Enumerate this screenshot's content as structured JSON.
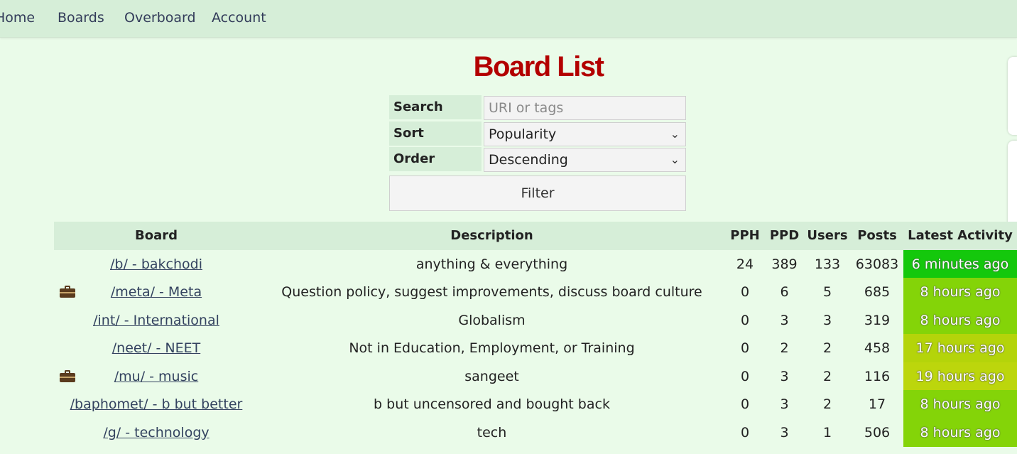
{
  "nav": {
    "home": "Home",
    "boards": "Boards",
    "overboard": "Overboard",
    "account": "Account"
  },
  "page_title": "Board List",
  "filter": {
    "search_label": "Search",
    "search_placeholder": "URI or tags",
    "sort_label": "Sort",
    "sort_value": "Popularity",
    "order_label": "Order",
    "order_value": "Descending",
    "filter_button": "Filter"
  },
  "table": {
    "headers": [
      "Board",
      "Description",
      "PPH",
      "PPD",
      "Users",
      "Posts",
      "Latest Activity"
    ],
    "rows": [
      {
        "board": "/b/ - bakchodi",
        "description": "anything & everything",
        "pph": "24",
        "ppd": "389",
        "users": "133",
        "posts": "63083",
        "activity": "6 minutes ago",
        "activity_color": "#14c80c",
        "sfw_icon": false
      },
      {
        "board": "/meta/ - Meta",
        "description": "Question policy, suggest improvements, discuss board culture",
        "pph": "0",
        "ppd": "6",
        "users": "5",
        "posts": "685",
        "activity": "8 hours ago",
        "activity_color": "#84d408",
        "sfw_icon": true
      },
      {
        "board": "/int/ - International",
        "description": "Globalism",
        "pph": "0",
        "ppd": "3",
        "users": "3",
        "posts": "319",
        "activity": "8 hours ago",
        "activity_color": "#84d408",
        "sfw_icon": false
      },
      {
        "board": "/neet/ - NEET",
        "description": "Not in Education, Employment, or Training",
        "pph": "0",
        "ppd": "2",
        "users": "2",
        "posts": "458",
        "activity": "17 hours ago",
        "activity_color": "#b4d40a",
        "sfw_icon": false
      },
      {
        "board": "/mu/ - music",
        "description": "sangeet",
        "pph": "0",
        "ppd": "3",
        "users": "2",
        "posts": "116",
        "activity": "19 hours ago",
        "activity_color": "#bcd60c",
        "sfw_icon": true
      },
      {
        "board": "/baphomet/ - b but better",
        "description": "b but uncensored and bought back",
        "pph": "0",
        "ppd": "3",
        "users": "2",
        "posts": "17",
        "activity": "8 hours ago",
        "activity_color": "#84d408",
        "sfw_icon": false
      },
      {
        "board": "/g/ - technology",
        "description": "tech",
        "pph": "0",
        "ppd": "3",
        "users": "1",
        "posts": "506",
        "activity": "8 hours ago",
        "activity_color": "#84d408",
        "sfw_icon": false
      }
    ]
  },
  "colors": {
    "background": "#eafbe9",
    "header_bg": "#d6eed8",
    "title": "#b30000",
    "link": "#33425f"
  },
  "icons": {
    "sfw": "briefcase-icon",
    "dropdown": "chevron-down-icon"
  }
}
